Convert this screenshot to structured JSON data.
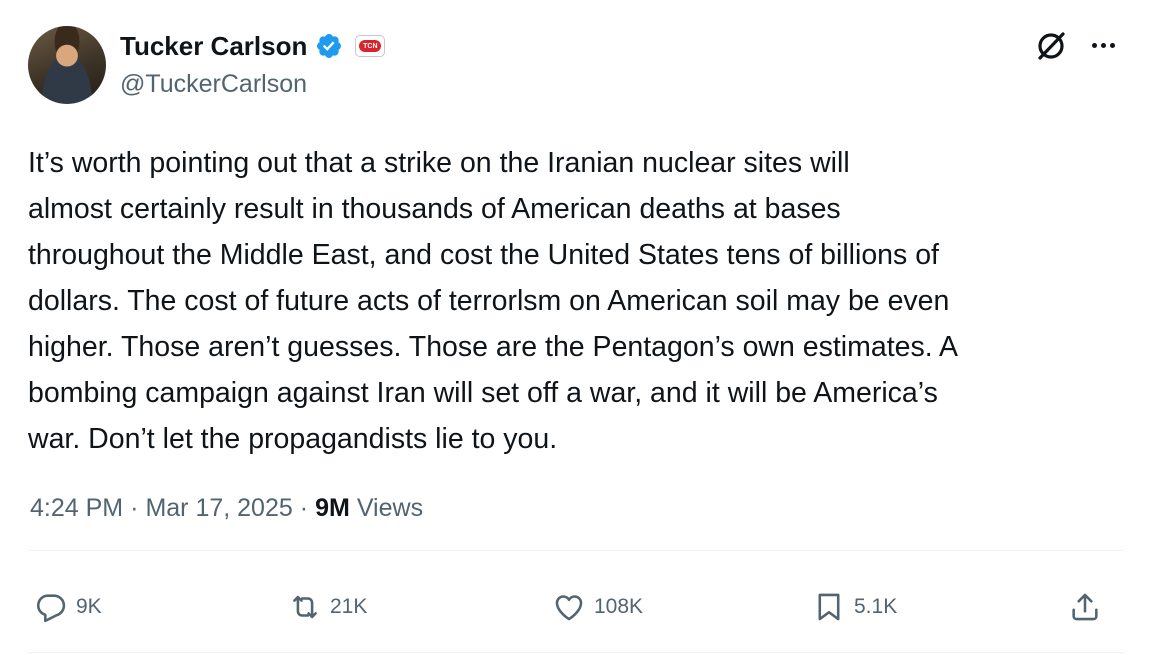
{
  "author": {
    "name": "Tucker Carlson",
    "handle": "@TuckerCarlson",
    "verified_color": "#1d9bf0",
    "affiliation_badge_text": "TCN"
  },
  "tweet": {
    "text": "It’s worth pointing out that a strike on the Iranian nuclear sites will\nalmost certainly result in thousands of American deaths at bases\nthroughout the Middle East, and cost the United States tens of billions of\ndollars. The cost of future acts of terrorlsm on American soil may be even\nhigher. Those aren’t guesses. Those are the Pentagon’s own estimates. A\nbombing campaign against Iran will set off a war, and it will be America’s\nwar. Don’t let the propagandists lie to you."
  },
  "meta": {
    "time": "4:24 PM",
    "date": "Mar 17, 2025",
    "views_count": "9M",
    "views_label": "Views",
    "separator": "·"
  },
  "actions": {
    "replies": "9K",
    "reposts": "21K",
    "likes": "108K",
    "bookmarks": "5.1K"
  },
  "icons": {
    "grok": "grok-icon",
    "more": "more-icon",
    "reply": "reply-icon",
    "repost": "repost-icon",
    "like": "like-icon",
    "bookmark": "bookmark-icon",
    "share": "share-icon"
  },
  "colors": {
    "text_primary": "#0f1419",
    "text_secondary": "#536471",
    "verified": "#1d9bf0"
  }
}
